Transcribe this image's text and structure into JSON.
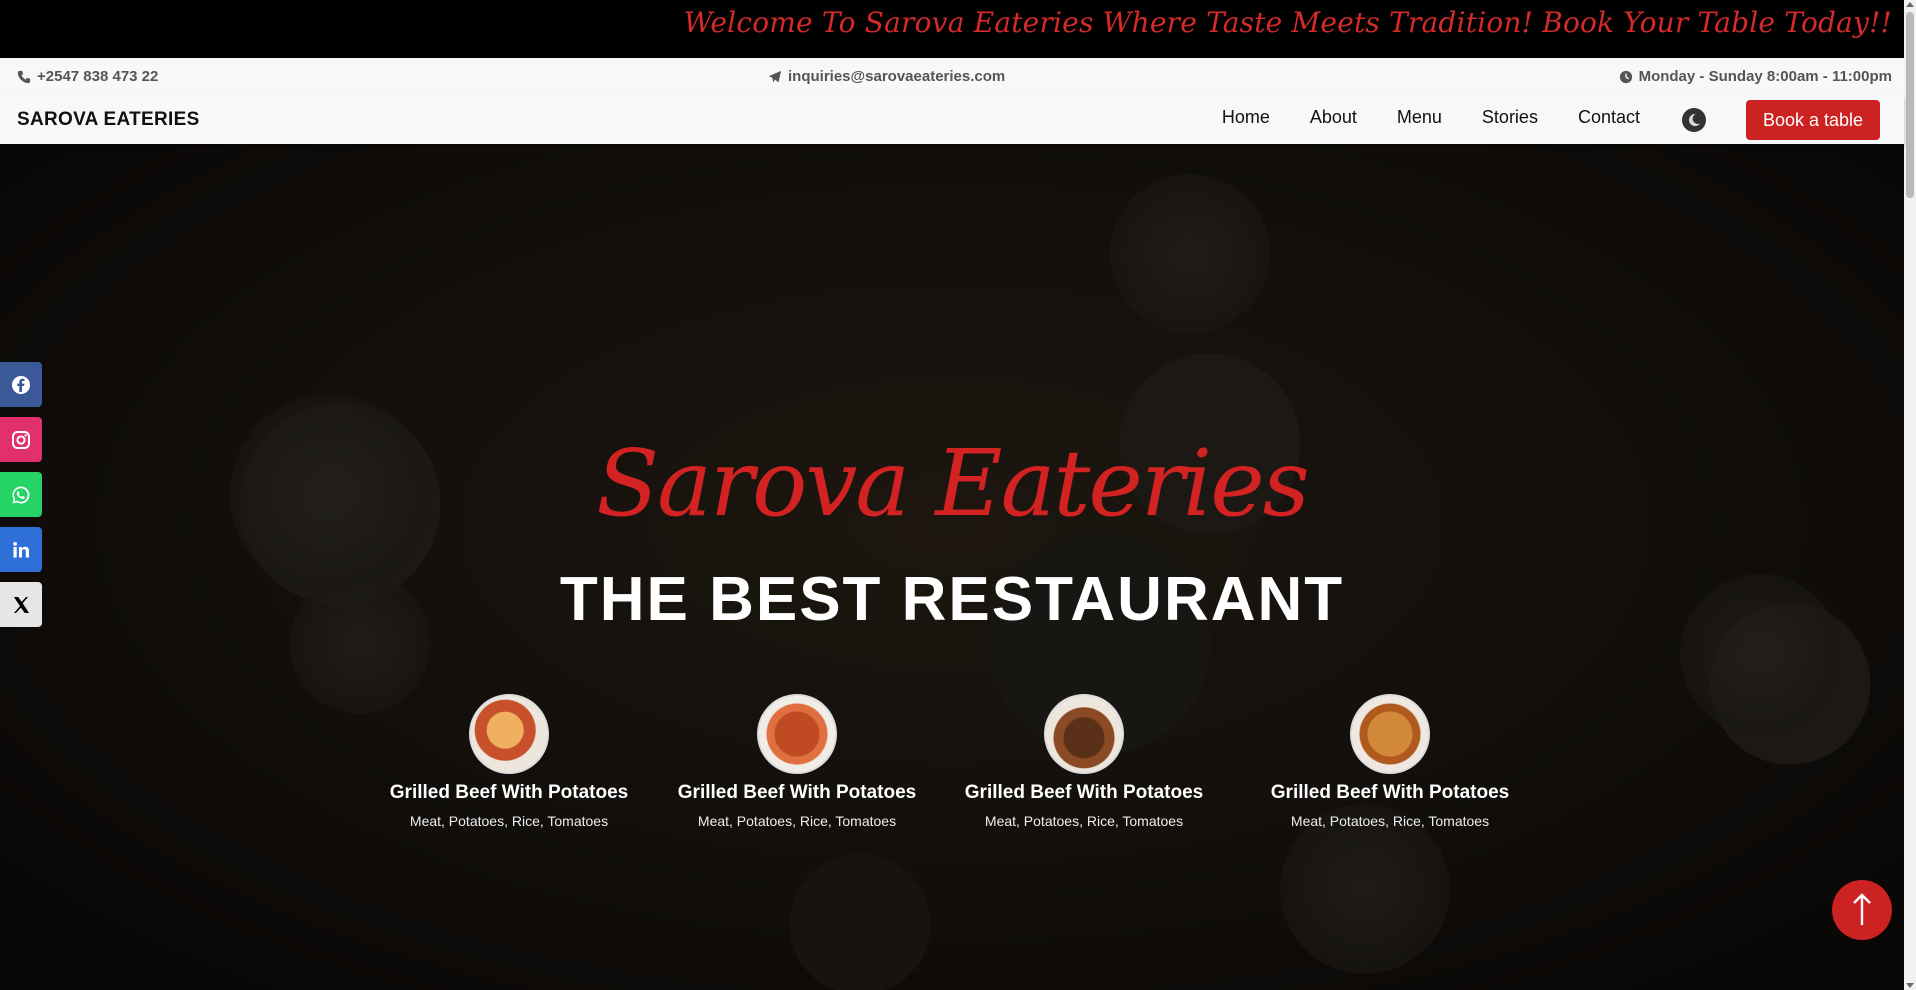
{
  "banner": {
    "text": "Welcome To Sarova Eateries Where Taste Meets Tradition! Book Your Table Today!!"
  },
  "infobar": {
    "phone": "+2547 838 473 22",
    "email": "inquiries@sarovaeateries.com",
    "hours": "Monday - Sunday 8:00am - 11:00pm",
    "icons": [
      "phone-icon",
      "paper-plane-icon",
      "clock-icon"
    ]
  },
  "navbar": {
    "brand": "SAROVA EATERIES",
    "links": [
      "Home",
      "About",
      "Menu",
      "Stories",
      "Contact"
    ],
    "theme_toggle_icon": "moon-icon",
    "book_label": "Book a table"
  },
  "hero": {
    "script_title": "Sarova Eateries",
    "heading": "THE BEST RESTAURANT",
    "dishes": [
      {
        "name": "Grilled Beef With Potatoes",
        "desc": "Meat, Potatoes, Rice, Tomatoes"
      },
      {
        "name": "Grilled Beef With Potatoes",
        "desc": "Meat, Potatoes, Rice, Tomatoes"
      },
      {
        "name": "Grilled Beef With Potatoes",
        "desc": "Meat, Potatoes, Rice, Tomatoes"
      },
      {
        "name": "Grilled Beef With Potatoes",
        "desc": "Meat, Potatoes, Rice, Tomatoes"
      }
    ]
  },
  "socials": [
    "facebook-icon",
    "instagram-icon",
    "whatsapp-icon",
    "linkedin-icon",
    "x-icon"
  ],
  "colors": {
    "accent": "#cc2222",
    "banner_bg": "#000000",
    "navbar_bg": "#f7f8fa"
  }
}
